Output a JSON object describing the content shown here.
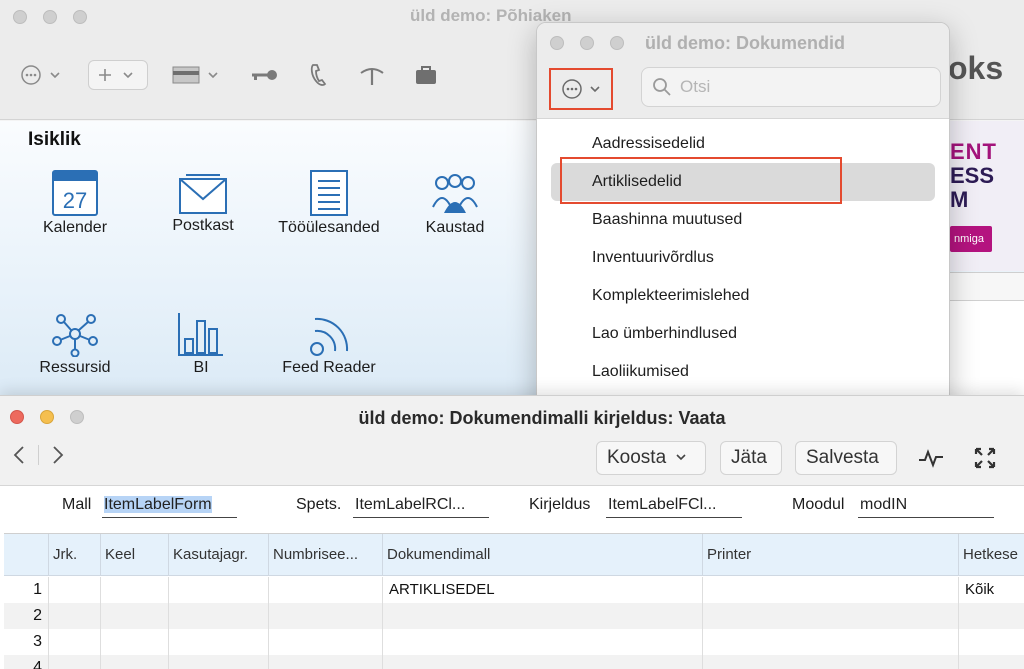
{
  "main_window": {
    "title": "üld demo: Põhiaken",
    "brand_fragment": "oks",
    "section_title": "Isiklik",
    "calendar_day": "27",
    "icons": [
      {
        "label": "Kalender",
        "icon": "calendar-icon"
      },
      {
        "label": "Postkast",
        "icon": "mail-icon"
      },
      {
        "label": "Tööülesanded",
        "icon": "task-list-icon"
      },
      {
        "label": "Kaustad",
        "icon": "people-folder-icon"
      },
      {
        "label": "Ressursid",
        "icon": "network-icon"
      },
      {
        "label": "BI",
        "icon": "bar-chart-icon"
      },
      {
        "label": "Feed Reader",
        "icon": "rss-feed-icon"
      }
    ],
    "promo": {
      "line1": "ENT",
      "line2": "ESS",
      "line3": "M",
      "button": "nmiga"
    }
  },
  "documents_window": {
    "title": "üld demo: Dokumendid",
    "search_placeholder": "Otsi",
    "items": [
      "Aadressisedelid",
      "Artiklisedelid",
      "Baashinna muutused",
      "Inventuurivõrdlus",
      "Komplekteerimislehed",
      "Lao ümberhindlused",
      "Laoliikumised"
    ],
    "selected_index": 1
  },
  "detail_window": {
    "title": "üld demo: Dokumendimalli kirjeldus: Vaata",
    "toolbar": {
      "koosta": "Koosta",
      "jata": "Jäta",
      "salvesta": "Salvesta"
    },
    "form": {
      "mall_label": "Mall",
      "mall_value": "ItemLabelForm",
      "spets_label": "Spets.",
      "spets_value": "ItemLabelRCl...",
      "kirjeldus_label": "Kirjeldus",
      "kirjeldus_value": "ItemLabelFCl...",
      "moodul_label": "Moodul",
      "moodul_value": "modIN"
    },
    "grid": {
      "columns": [
        "Jrk.",
        "Keel",
        "Kasutajagr.",
        "Numbrisee...",
        "Dokumendimall",
        "Printer",
        "Hetkese"
      ],
      "rows": [
        {
          "num": "1",
          "dokumendimall": "ARTIKLISEDEL",
          "hetkese": "Kõik"
        },
        {
          "num": "2",
          "dokumendimall": "",
          "hetkese": ""
        },
        {
          "num": "3",
          "dokumendimall": "",
          "hetkese": ""
        },
        {
          "num": "4",
          "dokumendimall": "",
          "hetkese": ""
        }
      ]
    }
  }
}
